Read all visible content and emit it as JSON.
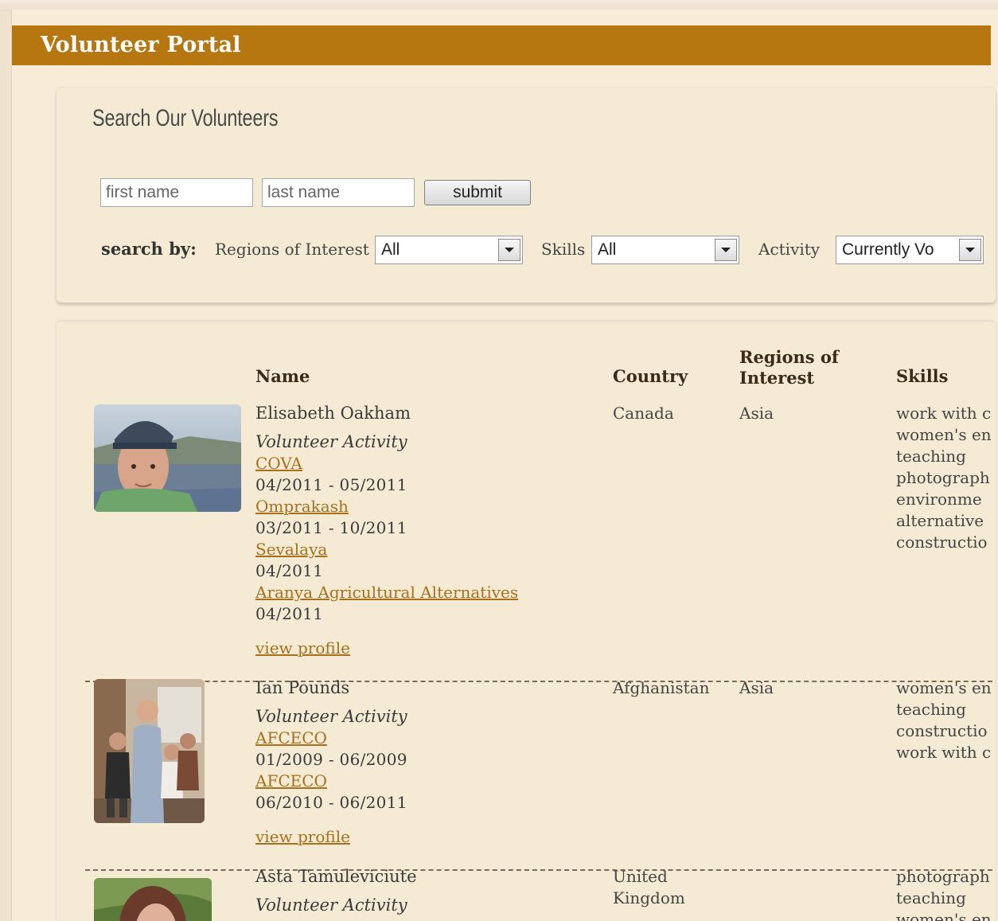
{
  "portal": {
    "title": "Volunteer Portal"
  },
  "search": {
    "title": "Search Our Volunteers",
    "first_name_placeholder": "first name",
    "last_name_placeholder": "last name",
    "submit_label": "submit",
    "search_by_label": "search by:",
    "regions_label": "Regions of Interest",
    "regions_value": "All",
    "skills_label": "Skills",
    "skills_value": "All",
    "activity_label": "Activity",
    "activity_value": "Currently Vo"
  },
  "table": {
    "headers": {
      "name": "Name",
      "country": "Country",
      "regions_line1": "Regions of",
      "regions_line2": "Interest",
      "skills": "Skills"
    },
    "volunteer_activity_label": "Volunteer Activity",
    "view_profile_label": "view profile",
    "rows": [
      {
        "name": "Elisabeth Oakham",
        "country": "Canada",
        "region": "Asia",
        "activities": [
          {
            "org": "COVA",
            "dates": "04/2011 - 05/2011"
          },
          {
            "org": "Omprakash",
            "dates": "03/2011 - 10/2011"
          },
          {
            "org": "Sevalaya",
            "dates": "04/2011"
          },
          {
            "org": "Aranya Agricultural Alternatives",
            "dates": "04/2011"
          }
        ],
        "skills": [
          "work with c",
          "women's en",
          "teaching",
          "photograph",
          "environme",
          "alternative",
          "constructio"
        ]
      },
      {
        "name": "Ian Pounds",
        "country": "Afghanistan",
        "region": "Asia",
        "activities": [
          {
            "org": "AFCECO",
            "dates": "01/2009 - 06/2009"
          },
          {
            "org": "AFCECO",
            "dates": "06/2010 - 06/2011"
          }
        ],
        "skills": [
          "women's en",
          "teaching",
          "constructio",
          "work with c"
        ]
      },
      {
        "name": "Asta Tamuleviciute",
        "country_line1": "United",
        "country_line2": "Kingdom",
        "skills": [
          "photograph",
          "teaching",
          "women's en"
        ]
      }
    ]
  }
}
